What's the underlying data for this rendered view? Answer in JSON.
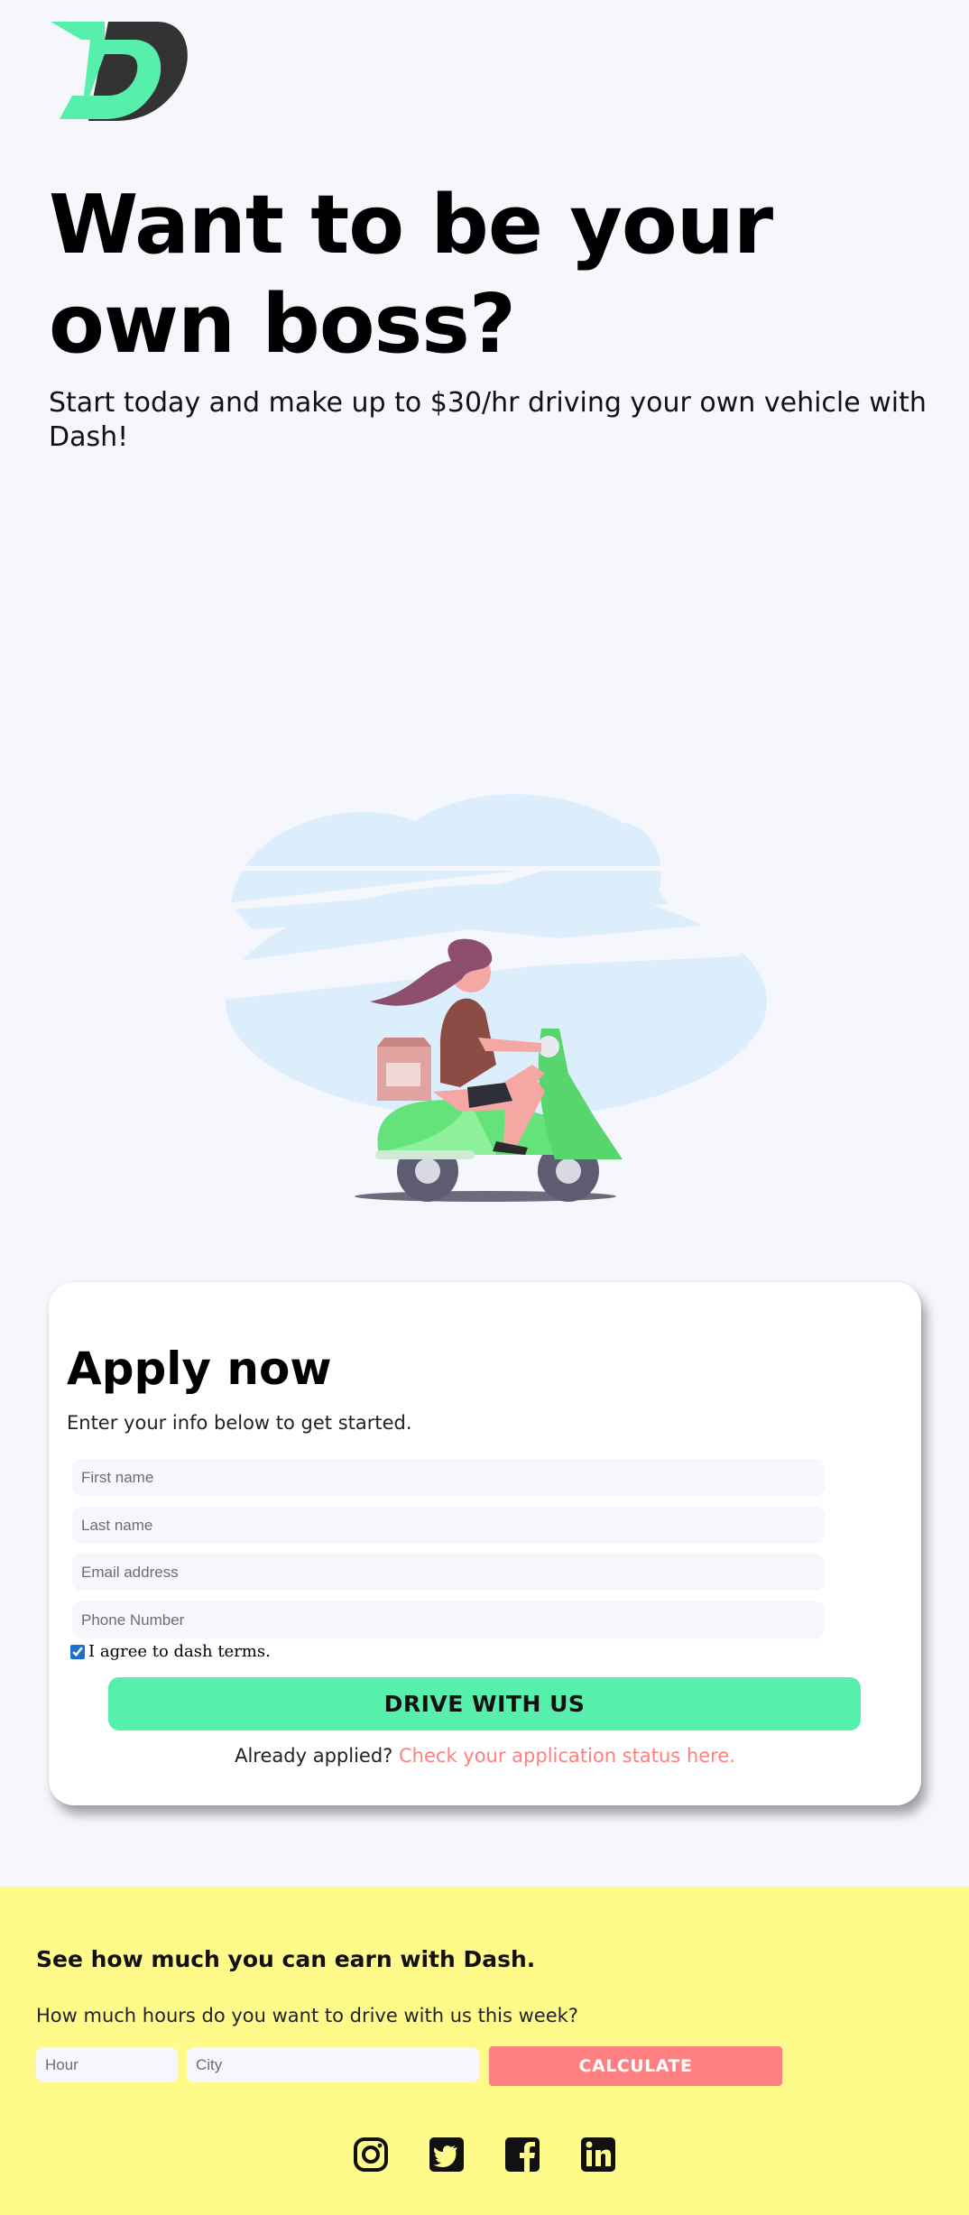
{
  "brand": {
    "logo_icon": "dash-logo-icon",
    "accent": "#57efac",
    "dark": "#2b2b2b"
  },
  "hero": {
    "title": "Want to be your own boss?",
    "subtitle": "Start today and make up to $30/hr driving your own vehicle with Dash!",
    "illustration_icon": "scooter-delivery-illustration"
  },
  "apply": {
    "title": "Apply now",
    "subtitle": "Enter your info below to get started.",
    "fields": {
      "first_name": {
        "placeholder": "First name",
        "value": ""
      },
      "last_name": {
        "placeholder": "Last name",
        "value": ""
      },
      "email": {
        "placeholder": "Email address",
        "value": ""
      },
      "phone": {
        "placeholder": "Phone Number",
        "value": ""
      }
    },
    "terms_label": "I agree to dash terms.",
    "terms_checked": true,
    "submit_label": "DRIVE WITH US",
    "already_text": "Already applied?",
    "status_link": "Check your application status here.",
    "link_color": "#ff7f7f"
  },
  "earn": {
    "title": "See how much you can earn with Dash.",
    "question": "How much hours do you want to drive with us this week?",
    "hour_placeholder": "Hour",
    "city_placeholder": "City",
    "calculate_label": "CALCULATE",
    "background": "#fffb8b",
    "button_color": "#ff8080"
  },
  "socials": [
    "instagram-icon",
    "twitter-icon",
    "facebook-icon",
    "linkedin-icon"
  ]
}
